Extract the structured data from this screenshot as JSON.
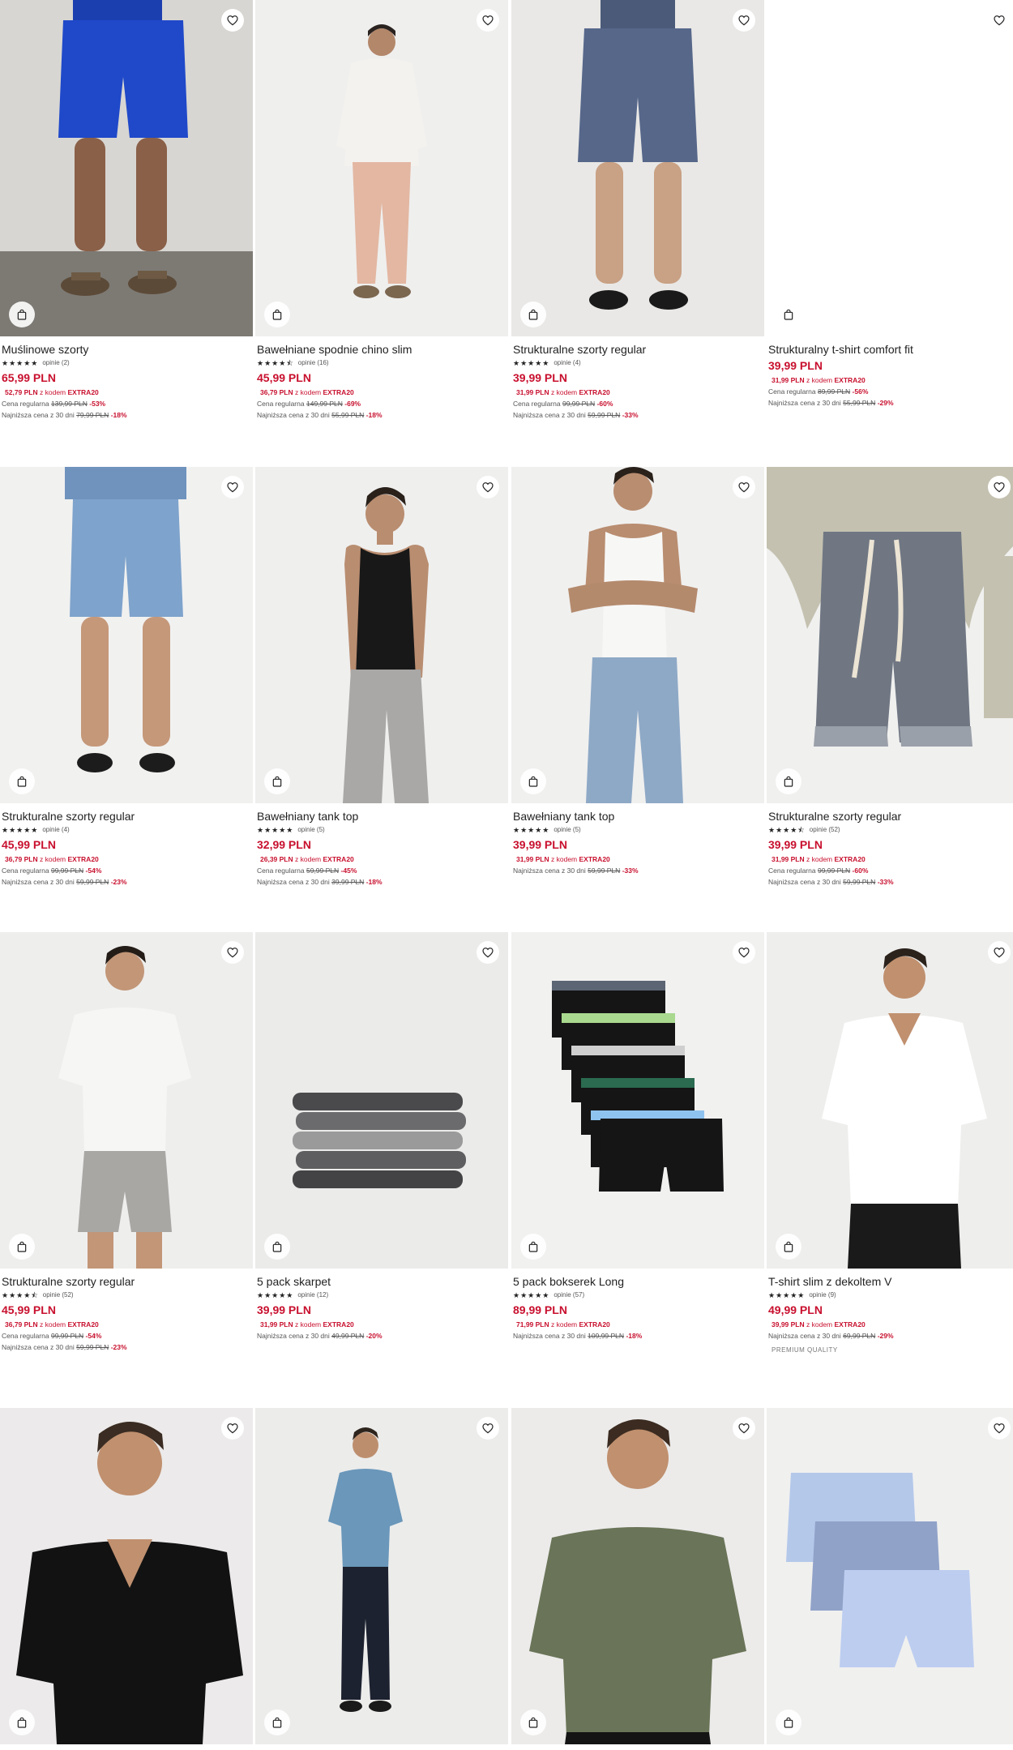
{
  "products": [
    {
      "name": "Muślinowe szorty",
      "stars": "★★★★★",
      "reviews": "opinie (2)",
      "price": "65,99 PLN",
      "promo_price": "52,79 PLN",
      "promo_mid": "z kodem",
      "promo_code": "EXTRA20",
      "lines": [
        {
          "label": "Cena regularna",
          "old": "139,99 PLN",
          "disc": "-53%"
        },
        {
          "label": "Najniższa cena z 30 dni",
          "old": "79,99 PLN",
          "disc": "-18%"
        }
      ],
      "tag": "",
      "image": "blue-shorts-sandals"
    },
    {
      "name": "Bawełniane spodnie chino slim",
      "stars": "★★★★⯪",
      "reviews": "opinie (16)",
      "price": "45,99 PLN",
      "promo_price": "36,79 PLN",
      "promo_mid": "z kodem",
      "promo_code": "EXTRA20",
      "lines": [
        {
          "label": "Cena regularna",
          "old": "149,99 PLN",
          "disc": "-69%"
        },
        {
          "label": "Najniższa cena z 30 dni",
          "old": "55,99 PLN",
          "disc": "-18%"
        }
      ],
      "tag": "",
      "image": "white-shirt-pink-chinos"
    },
    {
      "name": "Strukturalne szorty regular",
      "stars": "★★★★★",
      "reviews": "opinie (4)",
      "price": "39,99 PLN",
      "promo_price": "31,99 PLN",
      "promo_mid": "z kodem",
      "promo_code": "EXTRA20",
      "lines": [
        {
          "label": "Cena regularna",
          "old": "99,99 PLN",
          "disc": "-60%"
        },
        {
          "label": "Najniższa cena z 30 dni",
          "old": "59,99 PLN",
          "disc": "-33%"
        }
      ],
      "tag": "",
      "image": "navy-shorts-sandals"
    },
    {
      "name": "Strukturalny t-shirt comfort fit",
      "stars": "",
      "reviews": "",
      "price": "39,99 PLN",
      "promo_price": "31,99 PLN",
      "promo_mid": "z kodem",
      "promo_code": "EXTRA20",
      "lines": [
        {
          "label": "Cena regularna",
          "old": "89,99 PLN",
          "disc": "-56%"
        },
        {
          "label": "Najniższa cena z 30 dni",
          "old": "55,99 PLN",
          "disc": "-29%"
        }
      ],
      "tag": "",
      "image": "blank"
    },
    {
      "name": "Strukturalne szorty regular",
      "stars": "★★★★★",
      "reviews": "opinie (4)",
      "price": "45,99 PLN",
      "promo_price": "36,79 PLN",
      "promo_mid": "z kodem",
      "promo_code": "EXTRA20",
      "lines": [
        {
          "label": "Cena regularna",
          "old": "99,99 PLN",
          "disc": "-54%"
        },
        {
          "label": "Najniższa cena z 30 dni",
          "old": "59,99 PLN",
          "disc": "-23%"
        }
      ],
      "tag": "",
      "image": "light-blue-shorts"
    },
    {
      "name": "Bawełniany tank top",
      "stars": "★★★★★",
      "reviews": "opinie (5)",
      "price": "32,99 PLN",
      "promo_price": "26,39 PLN",
      "promo_mid": "z kodem",
      "promo_code": "EXTRA20",
      "lines": [
        {
          "label": "Cena regularna",
          "old": "59,99 PLN",
          "disc": "-45%"
        },
        {
          "label": "Najniższa cena z 30 dni",
          "old": "39,99 PLN",
          "disc": "-18%"
        }
      ],
      "tag": "",
      "image": "black-tank-grey-jeans"
    },
    {
      "name": "Bawełniany tank top",
      "stars": "★★★★★",
      "reviews": "opinie (5)",
      "price": "39,99 PLN",
      "promo_price": "31,99 PLN",
      "promo_mid": "z kodem",
      "promo_code": "EXTRA20",
      "lines": [
        {
          "label": "Najniższa cena z 30 dni",
          "old": "59,99 PLN",
          "disc": "-33%"
        }
      ],
      "tag": "",
      "image": "white-tank-blue-jeans"
    },
    {
      "name": "Strukturalne szorty regular",
      "stars": "★★★★⯪",
      "reviews": "opinie (52)",
      "price": "39,99 PLN",
      "promo_price": "31,99 PLN",
      "promo_mid": "z kodem",
      "promo_code": "EXTRA20",
      "lines": [
        {
          "label": "Cena regularna",
          "old": "99,99 PLN",
          "disc": "-60%"
        },
        {
          "label": "Najniższa cena z 30 dni",
          "old": "59,99 PLN",
          "disc": "-33%"
        }
      ],
      "tag": "",
      "image": "grey-melange-shorts"
    },
    {
      "name": "Strukturalne szorty regular",
      "stars": "★★★★⯪",
      "reviews": "opinie (52)",
      "price": "45,99 PLN",
      "promo_price": "36,79 PLN",
      "promo_mid": "z kodem",
      "promo_code": "EXTRA20",
      "lines": [
        {
          "label": "Cena regularna",
          "old": "99,99 PLN",
          "disc": "-54%"
        },
        {
          "label": "Najniższa cena z 30 dni",
          "old": "59,99 PLN",
          "disc": "-23%"
        }
      ],
      "tag": "",
      "image": "white-tee-grey-shorts"
    },
    {
      "name": "5 pack skarpet",
      "stars": "★★★★★",
      "reviews": "opinie (12)",
      "price": "39,99 PLN",
      "promo_price": "31,99 PLN",
      "promo_mid": "z kodem",
      "promo_code": "EXTRA20",
      "lines": [
        {
          "label": "Najniższa cena z 30 dni",
          "old": "49,99 PLN",
          "disc": "-20%"
        }
      ],
      "tag": "",
      "image": "folded-socks"
    },
    {
      "name": "5 pack bokserek Long",
      "stars": "★★★★★",
      "reviews": "opinie (57)",
      "price": "89,99 PLN",
      "promo_price": "71,99 PLN",
      "promo_mid": "z kodem",
      "promo_code": "EXTRA20",
      "lines": [
        {
          "label": "Najniższa cena z 30 dni",
          "old": "109,99 PLN",
          "disc": "-18%"
        }
      ],
      "tag": "",
      "image": "boxer-briefs-stack"
    },
    {
      "name": "T-shirt slim z dekoltem V",
      "stars": "★★★★★",
      "reviews": "opinie (9)",
      "price": "49,99 PLN",
      "promo_price": "39,99 PLN",
      "promo_mid": "z kodem",
      "promo_code": "EXTRA20",
      "lines": [
        {
          "label": "Najniższa cena z 30 dni",
          "old": "69,99 PLN",
          "disc": "-29%"
        }
      ],
      "tag": "PREMIUM QUALITY",
      "image": "white-vneck-tee"
    },
    {
      "name": "",
      "stars": "",
      "reviews": "",
      "price": "",
      "promo_price": "",
      "promo_mid": "",
      "promo_code": "",
      "lines": [],
      "tag": "",
      "image": "black-vneck-tee"
    },
    {
      "name": "",
      "stars": "",
      "reviews": "",
      "price": "",
      "promo_price": "",
      "promo_mid": "",
      "promo_code": "",
      "lines": [],
      "tag": "",
      "image": "blue-tee-navy-pants"
    },
    {
      "name": "",
      "stars": "",
      "reviews": "",
      "price": "",
      "promo_price": "",
      "promo_mid": "",
      "promo_code": "",
      "lines": [],
      "tag": "",
      "image": "olive-tee"
    },
    {
      "name": "",
      "stars": "",
      "reviews": "",
      "price": "",
      "promo_price": "",
      "promo_mid": "",
      "promo_code": "",
      "lines": [],
      "tag": "",
      "image": "boxer-shorts-pack"
    }
  ],
  "icons": {
    "favorite": "heart-outline-icon",
    "add_to_cart": "shopping-bag-icon"
  },
  "colors": {
    "price": "#c8102e",
    "text": "#222222",
    "muted": "#555555"
  }
}
